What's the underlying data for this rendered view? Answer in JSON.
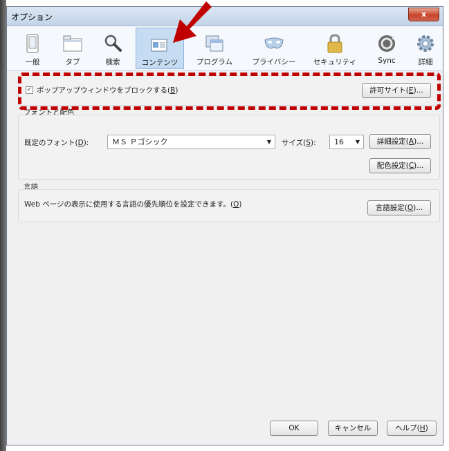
{
  "window": {
    "title": "オプション",
    "close": "x"
  },
  "toolbar": {
    "items": [
      {
        "label": "一般",
        "icon": "general-icon"
      },
      {
        "label": "タブ",
        "icon": "tab-icon"
      },
      {
        "label": "検索",
        "icon": "search-icon"
      },
      {
        "label": "コンテンツ",
        "icon": "content-icon"
      },
      {
        "label": "プログラム",
        "icon": "program-icon"
      },
      {
        "label": "プライバシー",
        "icon": "privacy-mask-icon"
      },
      {
        "label": "セキュリティ",
        "icon": "lock-icon"
      },
      {
        "label": "Sync",
        "icon": "sync-icon"
      },
      {
        "label": "詳細",
        "icon": "gear-icon"
      }
    ],
    "selected": "コンテンツ"
  },
  "popup": {
    "checkbox_label": "ポップアップウィンドウをブロックする(",
    "checkbox_key": "B",
    "checkbox_suffix": ")",
    "checked": true,
    "exceptions_button": "許可サイト(",
    "exceptions_key": "E",
    "exceptions_suffix": ")..."
  },
  "fonts": {
    "group_title": "フォントと配色",
    "default_font_label": "既定のフォント(",
    "default_font_key": "D",
    "default_font_suffix": "):",
    "default_font_value": "ＭＳ Ｐゴシック",
    "size_label": "サイズ(",
    "size_key": "S",
    "size_suffix": "):",
    "size_value": "16",
    "advanced_button": "詳細設定(",
    "advanced_key": "A",
    "advanced_suffix": ")...",
    "colors_button": "配色設定(",
    "colors_key": "C",
    "colors_suffix": ")..."
  },
  "languages": {
    "group_title": "言語",
    "description": "Web ページの表示に使用する言語の優先順位を設定できます。(",
    "description_key": "O",
    "description_suffix": ")",
    "choose_button": "言語設定(",
    "choose_key": "O",
    "choose_suffix": ")..."
  },
  "footer": {
    "ok": "OK",
    "cancel": "キャンセル",
    "help_label": "ヘルプ(",
    "help_key": "H",
    "help_suffix": ")"
  },
  "colors": {
    "annotation_red": "#c00000",
    "selected_tab": "#c5dcf3"
  }
}
